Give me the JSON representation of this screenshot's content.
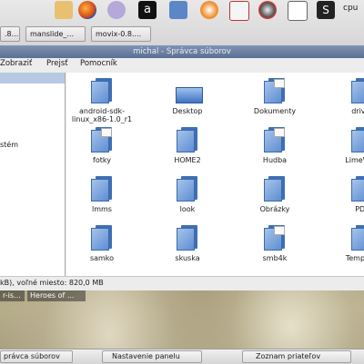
{
  "panel": {
    "launchers": [
      "firefox-icon",
      "gnome-foot-icon",
      "text-a-icon",
      "monitor-icon",
      "media-player-icon",
      "calendar-icon",
      "settings-gear-icon",
      "system-monitor-icon",
      "terminal-icon"
    ],
    "cpu_label": "cpu",
    "tasks": [
      ".8...",
      "manslide_...",
      "movix-0.8...."
    ]
  },
  "window": {
    "title": "michal - Správca súborov",
    "menu": [
      "Zobraziť",
      "Prejsť",
      "Pomocník"
    ],
    "path_label": "michal",
    "sidebar_item": "stém",
    "status": "kB), voľné miesto: 820,0 MB"
  },
  "items": [
    {
      "label": "android-sdk-linux_x86-1.0_r1",
      "icon": "folder-icon"
    },
    {
      "label": "Desktop",
      "icon": "desktop-icon"
    },
    {
      "label": "Dokumenty",
      "icon": "documents-folder-icon"
    },
    {
      "label": "driver",
      "icon": "folder-icon"
    },
    {
      "label": "fotky",
      "icon": "pictures-folder-icon"
    },
    {
      "label": "HOME2",
      "icon": "folder-icon"
    },
    {
      "label": "Hudba",
      "icon": "music-folder-icon"
    },
    {
      "label": "LimeWire",
      "icon": "folder-icon"
    },
    {
      "label": "lmms",
      "icon": "folder-icon"
    },
    {
      "label": "look",
      "icon": "folder-icon"
    },
    {
      "label": "Obrázky",
      "icon": "folder-icon"
    },
    {
      "label": "PDF",
      "icon": "folder-icon"
    },
    {
      "label": "samko",
      "icon": "folder-icon"
    },
    {
      "label": "skuska",
      "icon": "folder-icon"
    },
    {
      "label": "smb4k",
      "icon": "network-folder-icon"
    },
    {
      "label": "Template",
      "icon": "folder-icon"
    }
  ],
  "mini_tasks": [
    "r-is...",
    "Heroes of ..."
  ],
  "bottom_tasks": [
    "právca súborov",
    "Nastavenie panelu",
    "Zoznam priateľov"
  ]
}
